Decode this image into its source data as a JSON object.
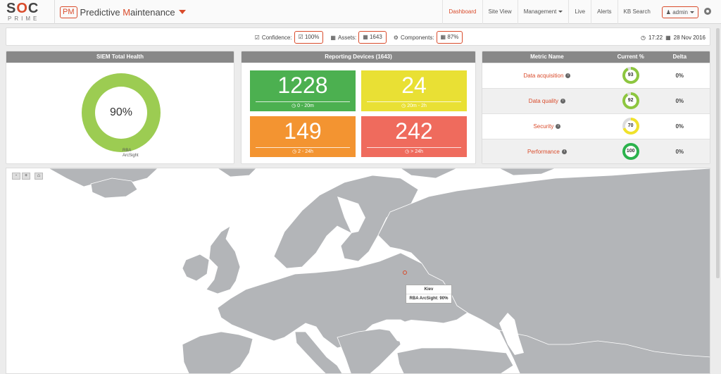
{
  "logo": {
    "line1a": "S",
    "line1b": "O",
    "line1c": "C",
    "line2": "PRIME"
  },
  "brand": {
    "pm": "PM",
    "title_a": "Predictive ",
    "title_b": "M",
    "title_c": "aintenance"
  },
  "nav": {
    "dashboard": "Dashboard",
    "site_view": "Site View",
    "management": "Management",
    "live": "Live",
    "alerts": "Alerts",
    "kb_search": "KB Search",
    "admin": "admin"
  },
  "stats": {
    "confidence_label": "Confidence:",
    "confidence_value": "100%",
    "assets_label": "Assets:",
    "assets_value": "1643",
    "components_label": "Components:",
    "components_value": "87%",
    "time": "17:22",
    "date": "28 Nov 2016"
  },
  "siem": {
    "title": "SIEM Total Health",
    "value": "90%",
    "legend_1": "RBA",
    "legend_2": "ArcSight",
    "color": "#9ccc52"
  },
  "devices": {
    "title": "Reporting Devices (1643)",
    "tiles": [
      {
        "count": "1228",
        "range": "0 - 20m",
        "color": "#4cb050"
      },
      {
        "count": "24",
        "range": "20m - 2h",
        "color": "#e9e034"
      },
      {
        "count": "149",
        "range": "2 - 24h",
        "color": "#f39431"
      },
      {
        "count": "242",
        "range": "> 24h",
        "color": "#ef6b5d"
      }
    ]
  },
  "metrics": {
    "headers": {
      "name": "Metric Name",
      "current": "Current %",
      "delta": "Delta"
    },
    "rows": [
      {
        "name": "Data acquisition",
        "current": "93",
        "delta": "0%",
        "color": "#8dc63f"
      },
      {
        "name": "Data quality",
        "current": "92",
        "delta": "0%",
        "color": "#8dc63f"
      },
      {
        "name": "Security",
        "current": "70",
        "delta": "0%",
        "color": "#f0e22b"
      },
      {
        "name": "Performance",
        "current": "100",
        "delta": "0%",
        "color": "#2bb24c"
      }
    ]
  },
  "map": {
    "zoom_out": "-",
    "zoom_in": "+",
    "tooltip_title": "Kiev",
    "tooltip_value": "RBA ArcSight: 90%"
  }
}
